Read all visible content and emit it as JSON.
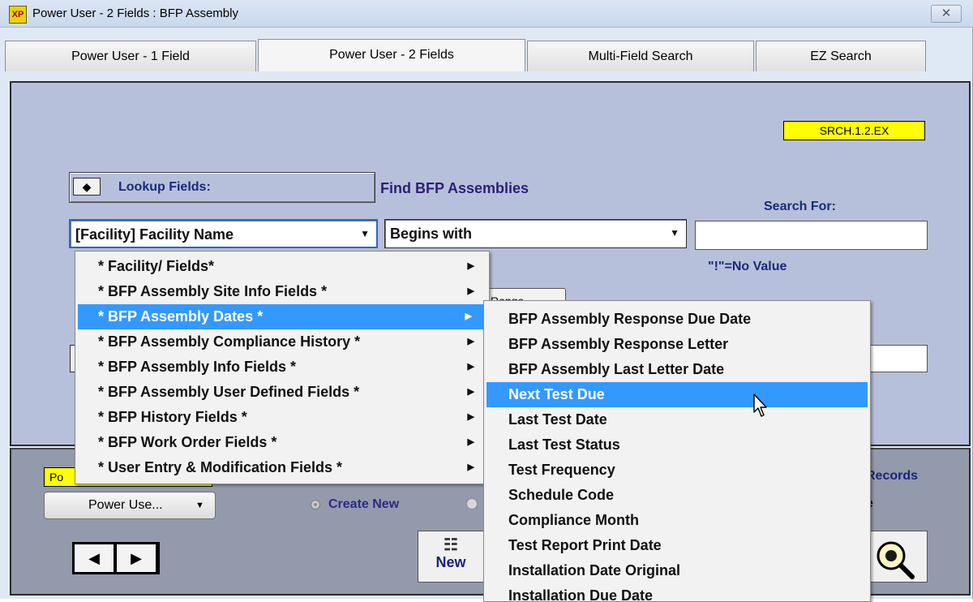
{
  "window": {
    "title": "Power User - 2 Fields : BFP Assembly",
    "app_icon_text": "XP",
    "close_glyph": "✕"
  },
  "tabs": [
    {
      "label": "Power User - 1 Field",
      "active": false
    },
    {
      "label": "Power User - 2 Fields",
      "active": true
    },
    {
      "label": "Multi-Field Search",
      "active": false
    },
    {
      "label": "EZ Search",
      "active": false
    }
  ],
  "main": {
    "code_badge": "SRCH.1.2.EX",
    "lookup_toggle_glyph": "◆",
    "lookup_label": "Lookup Fields:",
    "find_title": "Find BFP Assemblies",
    "search_for_label": "Search For:",
    "field_combo_value": "[Facility] Facility Name",
    "operator_combo_value": "Begins with",
    "search_input_value": "",
    "no_value_note": "\"!\"=No Value",
    "range_peek_text": "Range"
  },
  "bottom": {
    "yellow_tag": "Po",
    "mode_combo_value": "Power Use...",
    "create_new_label": "Create New",
    "nav_prev_glyph": "◀",
    "nav_next_glyph": "▶",
    "new_button_label": "New",
    "records_text": "Records",
    "e_text": "e"
  },
  "menu_categories": [
    {
      "label": "* Facility/ Fields*",
      "highlighted": false
    },
    {
      "label": "* BFP Assembly Site Info Fields *",
      "highlighted": false
    },
    {
      "label": "* BFP Assembly Dates *",
      "highlighted": true
    },
    {
      "label": "* BFP Assembly Compliance History *",
      "highlighted": false
    },
    {
      "label": "* BFP Assembly Info Fields *",
      "highlighted": false
    },
    {
      "label": "* BFP Assembly User Defined Fields *",
      "highlighted": false
    },
    {
      "label": "* BFP History Fields *",
      "highlighted": false
    },
    {
      "label": "* BFP Work Order Fields *",
      "highlighted": false
    },
    {
      "label": "* User Entry & Modification Fields *",
      "highlighted": false
    }
  ],
  "submenu_items": [
    {
      "label": "BFP Assembly Response Due Date",
      "highlighted": false
    },
    {
      "label": "BFP Assembly Response Letter",
      "highlighted": false
    },
    {
      "label": "BFP Assembly Last Letter Date",
      "highlighted": false
    },
    {
      "label": "Next Test Due",
      "highlighted": true
    },
    {
      "label": "Last Test Date",
      "highlighted": false
    },
    {
      "label": "Last Test Status",
      "highlighted": false
    },
    {
      "label": "Test Frequency",
      "highlighted": false
    },
    {
      "label": "Schedule Code",
      "highlighted": false
    },
    {
      "label": "Compliance Month",
      "highlighted": false
    },
    {
      "label": "Test Report Print Date",
      "highlighted": false
    },
    {
      "label": "Installation Date Original",
      "highlighted": false
    },
    {
      "label": "Installation Due Date",
      "highlighted": false
    }
  ],
  "icons": {
    "new_icon": "list-icon",
    "search_icon": "magnifier-icon",
    "cursor": "mouse-pointer-icon"
  }
}
